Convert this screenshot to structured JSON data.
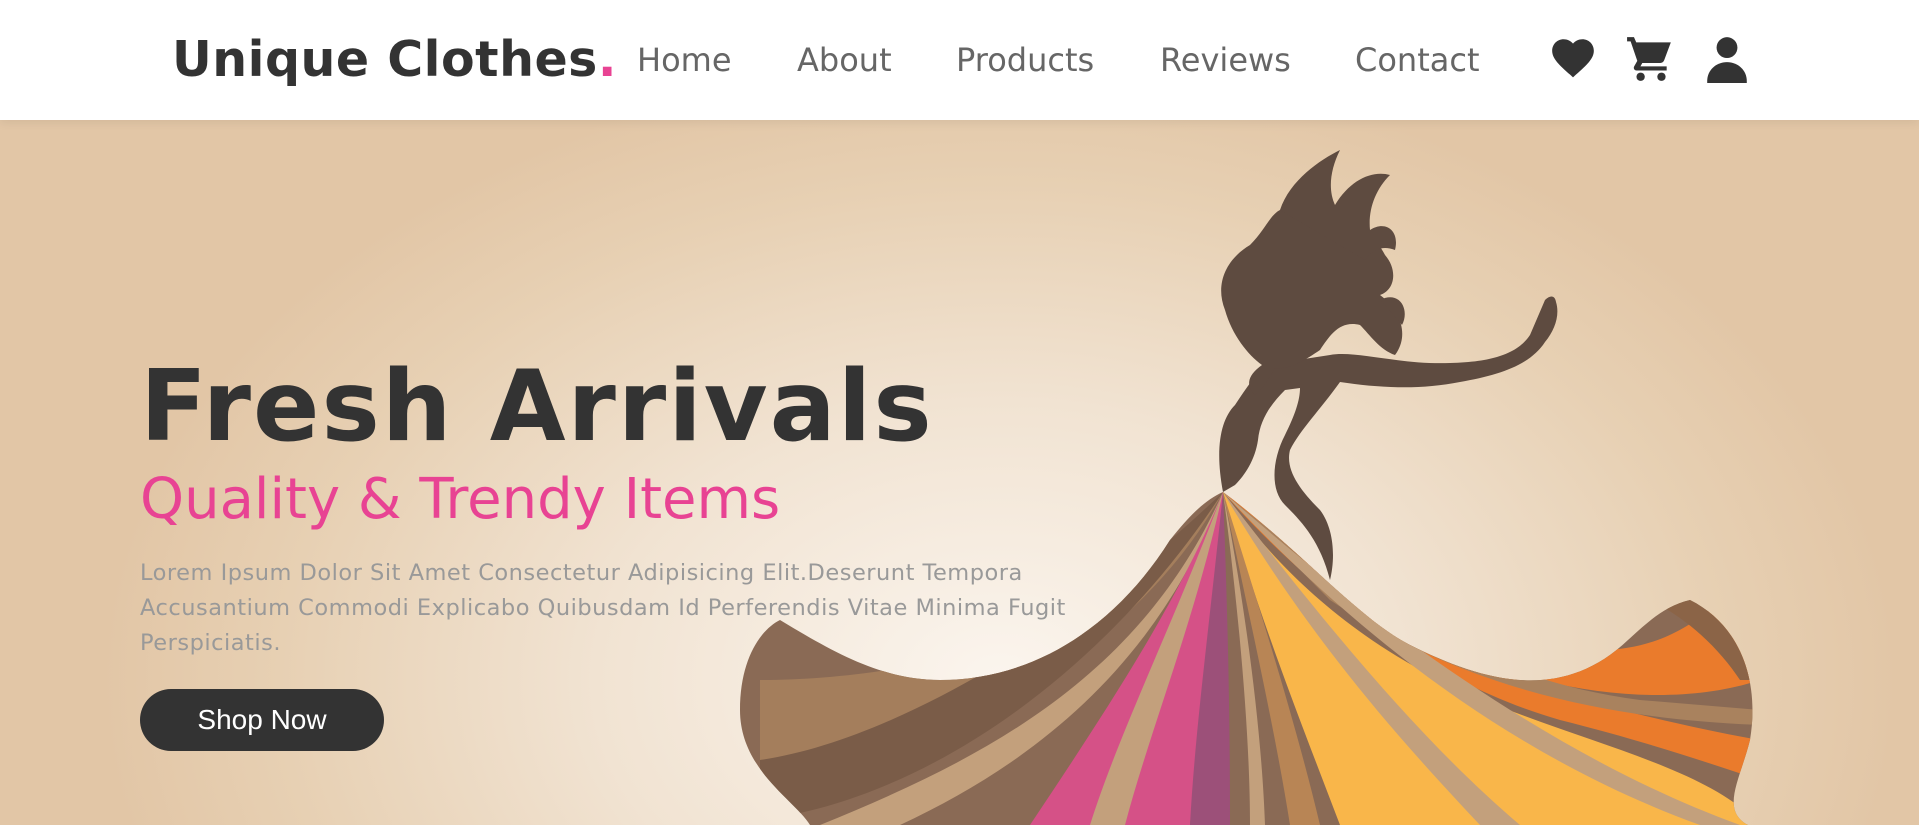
{
  "header": {
    "logo_text": "Unique Clothes",
    "logo_dot": ".",
    "nav": [
      "Home",
      "About",
      "Products",
      "Reviews",
      "Contact"
    ],
    "icons": [
      "heart-icon",
      "cart-icon",
      "user-icon"
    ]
  },
  "hero": {
    "title": "Fresh Arrivals",
    "subtitle": "Quality & Trendy Items",
    "description": "Lorem Ipsum Dolor Sit Amet Consectetur Adipisicing Elit.Deserunt Tempora Accusantium Commodi Explicabo Quibusdam Id Perferendis Vitae Minima Fugit Perspiciatis.",
    "button_label": "Shop Now"
  },
  "colors": {
    "accent": "#e84393",
    "dark": "#333333",
    "nav_text": "#666666",
    "muted_text": "#999999",
    "hero_bg": "#e7d0b3"
  }
}
